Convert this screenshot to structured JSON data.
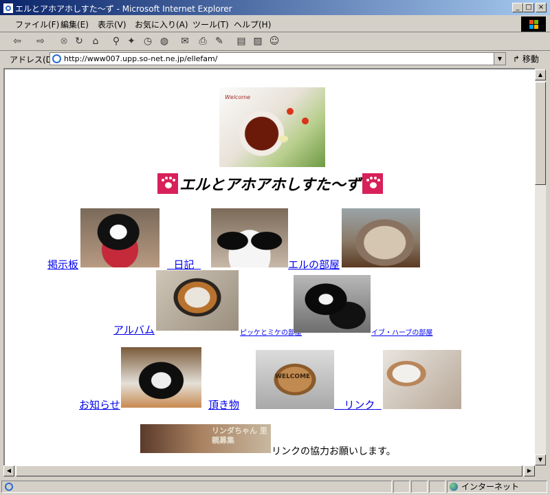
{
  "window": {
    "title": "エルとアホアホしすた～ず - Microsoft Internet Explorer",
    "controls": {
      "minimize": "_",
      "maximize": "□",
      "close": "×"
    }
  },
  "menu": [
    "ファイル(F)",
    "編集(E)",
    "表示(V)",
    "お気に入り(A)",
    "ツール(T)",
    "ヘルプ(H)"
  ],
  "toolbar_icons": [
    "back-icon",
    "forward-icon",
    "stop-icon",
    "refresh-icon",
    "home-icon",
    "search-icon",
    "favorites-icon",
    "history-icon",
    "mail-icon",
    "print-icon",
    "edit-icon",
    "discuss-icon",
    "messenger-icon"
  ],
  "address": {
    "label": "アドレス(D)",
    "url": "http://www007.upp.so-net.ne.jp/ellefam/",
    "go": "移動"
  },
  "page": {
    "welcome_text": "Welcome",
    "heading": "エルとアホアホしすた～ず",
    "links": {
      "bbs": "掲示板",
      "diary": "日記",
      "elle_room": "エルの部屋",
      "album": "アルバム",
      "picky_mike": "ピッケとミケの部屋",
      "eve_herb": "イブ・ハーブの部屋",
      "news": "お知らせ",
      "gifts": "頂き物",
      "link": "リンク"
    },
    "banner_text": "リンダちゃん 里親募集",
    "cooperation": "リンクの協力お願いします。"
  },
  "status": {
    "zone": "インターネット"
  },
  "colors": {
    "titlebar": "#0a246a",
    "link": "#0000ee",
    "paw": "#d8205a"
  }
}
